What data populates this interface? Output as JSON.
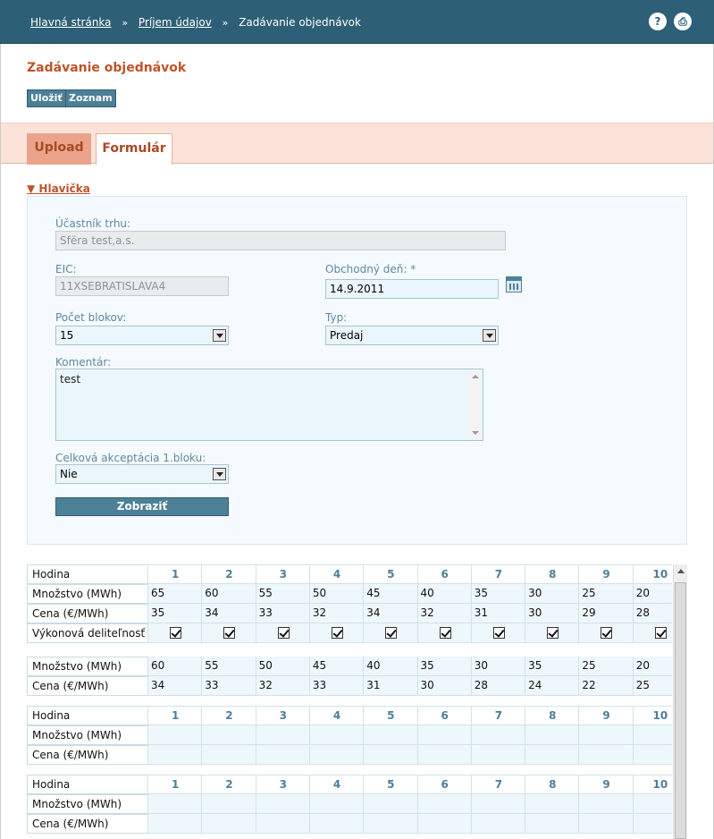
{
  "breadcrumb": {
    "home": "Hlavná stránka",
    "receive": "Príjem údajov",
    "current": "Zadávanie objednávok",
    "separator": "»"
  },
  "topbar_icons": [
    {
      "name": "help-icon",
      "glyph": "?"
    },
    {
      "name": "print-icon",
      "glyph": "⎙"
    }
  ],
  "page": {
    "title": "Zadávanie objednávok",
    "save_label": "Uložiť",
    "list_label": "Zoznam"
  },
  "tabs": {
    "upload": "Upload",
    "form": "Formulár"
  },
  "header_section": {
    "toggle_label": "▼ Hlavička",
    "participant": {
      "label": "Účastník trhu:",
      "value": "Sfëra test,a.s."
    },
    "eic": {
      "label": "EIC:",
      "value": "11XSEBRATISLAVA4"
    },
    "trade_day": {
      "label": "Obchodný deň: *",
      "value": "14.9.2011"
    },
    "block_count": {
      "label": "Počet blokov:",
      "value": "15"
    },
    "type": {
      "label": "Typ:",
      "value": "Predaj"
    },
    "comment": {
      "label": "Komentár:",
      "value": "test"
    },
    "acceptance": {
      "label": "Celková akceptácia 1.bloku:",
      "value": "Nie"
    },
    "show_button": "Zobraziť"
  },
  "grid": {
    "row_labels": {
      "hour": "Hodina",
      "quantity": "Množstvo (MWh)",
      "price": "Cena (€/MWh)",
      "divisibility": "Výkonová deliteľnosť"
    },
    "hours": [
      "1",
      "2",
      "3",
      "4",
      "5",
      "6",
      "7",
      "8",
      "9",
      "10"
    ],
    "block1": {
      "quantity": [
        "65",
        "60",
        "55",
        "50",
        "45",
        "40",
        "35",
        "30",
        "25",
        "20"
      ],
      "price": [
        "35",
        "34",
        "33",
        "32",
        "34",
        "32",
        "31",
        "30",
        "29",
        "28"
      ],
      "divisibility": [
        true,
        true,
        true,
        true,
        true,
        true,
        true,
        true,
        true,
        true
      ]
    },
    "block2": {
      "quantity": [
        "60",
        "55",
        "50",
        "45",
        "40",
        "35",
        "30",
        "35",
        "25",
        "20"
      ],
      "price": [
        "34",
        "33",
        "32",
        "33",
        "31",
        "30",
        "28",
        "24",
        "22",
        "25"
      ]
    },
    "block3": {
      "quantity": [
        "",
        "",
        "",
        "",
        "",
        "",
        "",
        "",
        "",
        ""
      ],
      "price": [
        "",
        "",
        "",
        "",
        "",
        "",
        "",
        "",
        "",
        ""
      ]
    },
    "block4": {
      "quantity": [
        "",
        "",
        "",
        "",
        "",
        "",
        "",
        "",
        "",
        ""
      ],
      "price": [
        "",
        "",
        "",
        "",
        "",
        "",
        "",
        "",
        "",
        ""
      ]
    }
  }
}
